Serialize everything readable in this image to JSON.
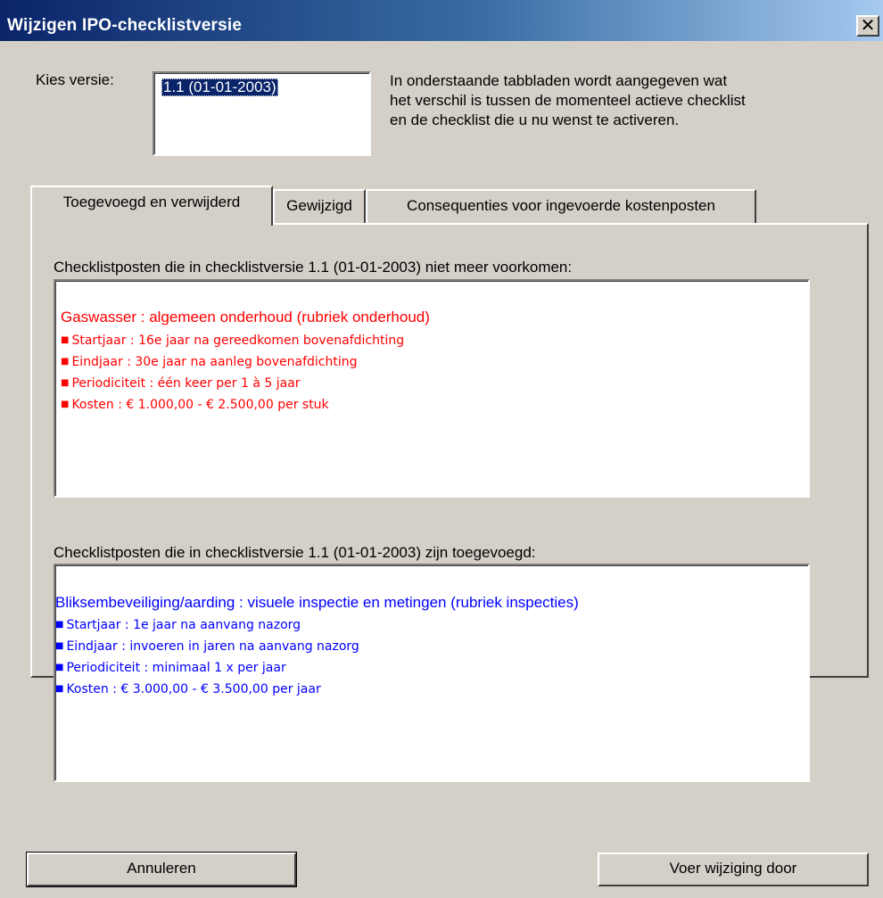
{
  "window": {
    "title": "Wijzigen IPO-checklistversie",
    "close_glyph": "✕"
  },
  "version_select": {
    "label": "Kies versie:",
    "items": [
      "1.1 (01-01-2003)"
    ],
    "selected": "1.1 (01-01-2003)"
  },
  "info_text": [
    "In onderstaande tabbladen wordt aangegeven wat",
    "het verschil is tussen de momenteel actieve checklist",
    "en de checklist die u nu wenst te activeren."
  ],
  "tabs": [
    {
      "label": "Toegevoegd en verwijderd",
      "active": true
    },
    {
      "label": "Gewijzigd",
      "active": false
    },
    {
      "label": "Consequenties voor ingevoerde kostenposten",
      "active": false
    }
  ],
  "removed_section": {
    "heading": "Checklistposten die in checklistversie 1.1 (01-01-2003) niet meer voorkomen:",
    "item_title": "Gaswasser : algemeen onderhoud (rubriek onderhoud)",
    "details": [
      "Startjaar : 16e jaar na gereedkomen bovenafdichting",
      "Eindjaar : 30e jaar na aanleg bovenafdichting",
      "Periodiciteit : één keer per 1 à 5 jaar",
      "Kosten : € 1.000,00 - € 2.500,00 per stuk"
    ],
    "color": "#ff0000"
  },
  "added_section": {
    "heading": "Checklistposten die in checklistversie 1.1 (01-01-2003) zijn toegevoegd:",
    "item_title": "Bliksembeveiliging/aarding : visuele inspectie en metingen (rubriek inspecties)",
    "details": [
      "Startjaar : 1e jaar na aanvang nazorg",
      "Eindjaar : invoeren in jaren na aanvang nazorg",
      "Periodiciteit : minimaal 1 x per jaar",
      "Kosten : € 3.000,00 - € 3.500,00 per jaar"
    ],
    "color": "#0000ff"
  },
  "buttons": {
    "cancel": "Annuleren",
    "apply": "Voer wijziging door"
  },
  "colors": {
    "face": "#d4d0c8",
    "title_start": "#0a246a",
    "title_end": "#a6caf0",
    "selection": "#0a246a"
  },
  "icons": {
    "close": "close-icon",
    "bullet": "bullet-icon"
  }
}
